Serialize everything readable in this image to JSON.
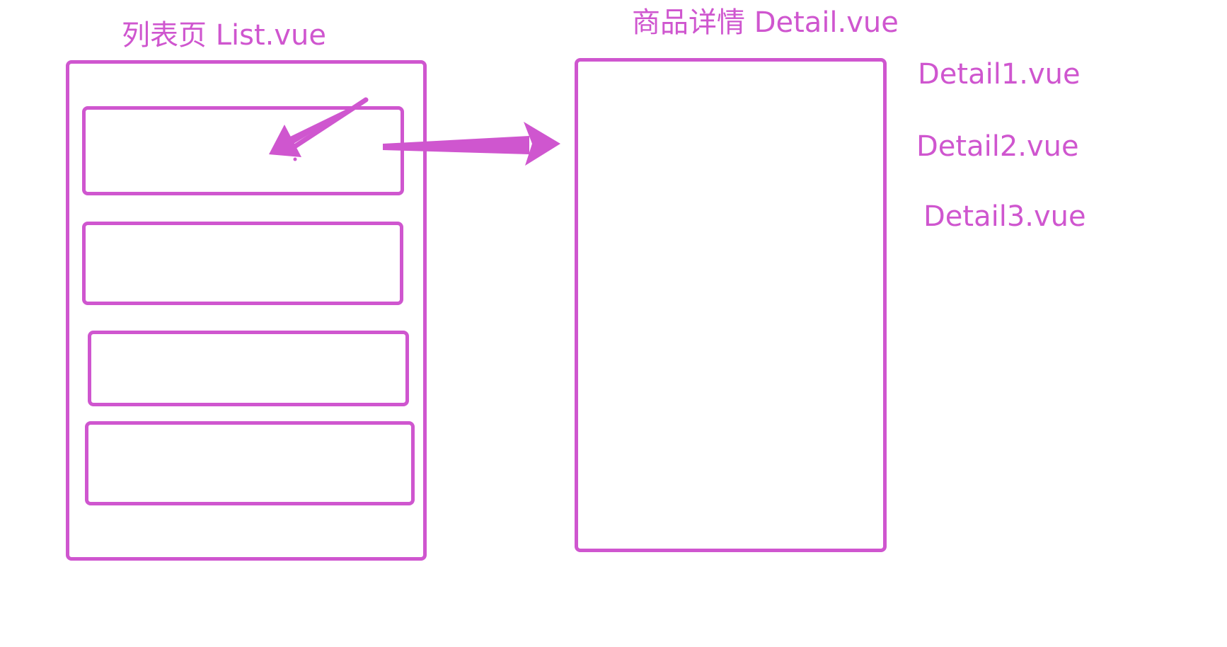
{
  "diagram": {
    "accent_color": "#cf56cf",
    "list_page": {
      "title": "列表页 List.vue",
      "items": [
        "",
        "",
        "",
        ""
      ]
    },
    "detail_page": {
      "title": "商品详情 Detail.vue"
    },
    "detail_files": [
      "Detail1.vue",
      "Detail2.vue",
      "Detail3.vue"
    ]
  }
}
